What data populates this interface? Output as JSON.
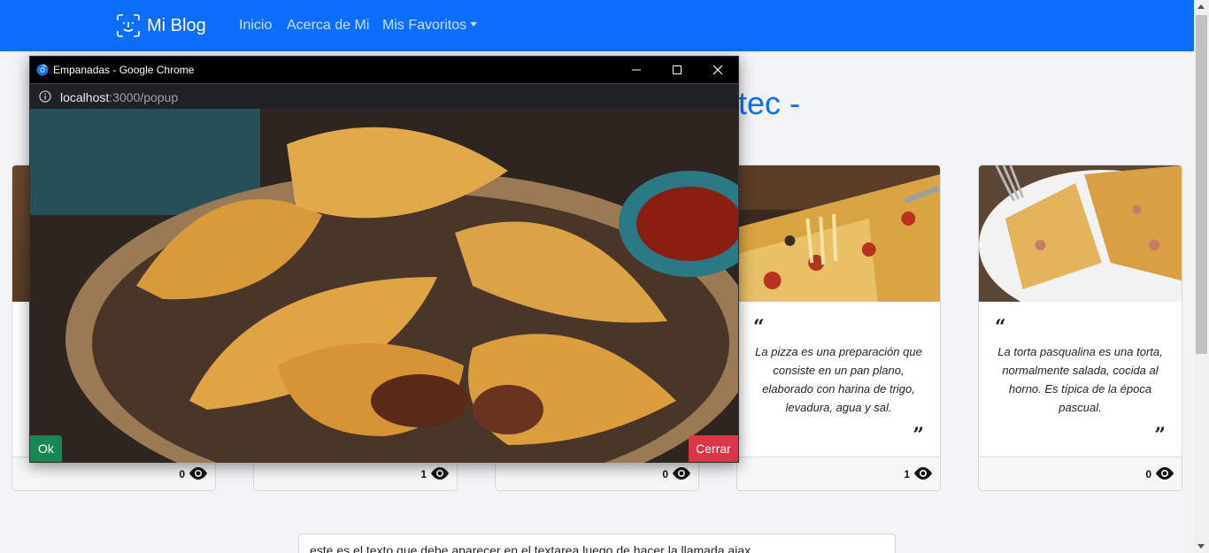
{
  "navbar": {
    "brand": "Mi Blog",
    "links": [
      "Inicio",
      "Acerca de Mi",
      "Mis Favoritos"
    ]
  },
  "heading_fragment": "tec -",
  "cards": [
    {
      "views": "0"
    },
    {
      "views": "1"
    },
    {
      "views": "0"
    },
    {
      "text": "La pizza es una preparación que consiste en un pan plano, elaborado con harina de trigo, levadura, agua y sal.",
      "views": "1"
    },
    {
      "text": "La torta pasqualina es una torta, normalmente salada, cocida al horno. Es típica de la época pascual.",
      "views": "0"
    }
  ],
  "textarea": {
    "value": "este es el texto que debe aparecer en el textarea luego de hacer la llamada ajax"
  },
  "popup": {
    "window_title": "Empanadas - Google Chrome",
    "url_host": "localhost",
    "url_rest": ":3000/popup",
    "ok_label": "Ok",
    "close_label": "Cerrar"
  },
  "icons": [
    "face-id-icon",
    "eye-icon",
    "info-icon",
    "chrome-icon",
    "minimize-icon",
    "maximize-icon",
    "close-icon"
  ],
  "colors": {
    "primary": "#0d6efd",
    "success": "#198754",
    "danger": "#dc3545"
  }
}
